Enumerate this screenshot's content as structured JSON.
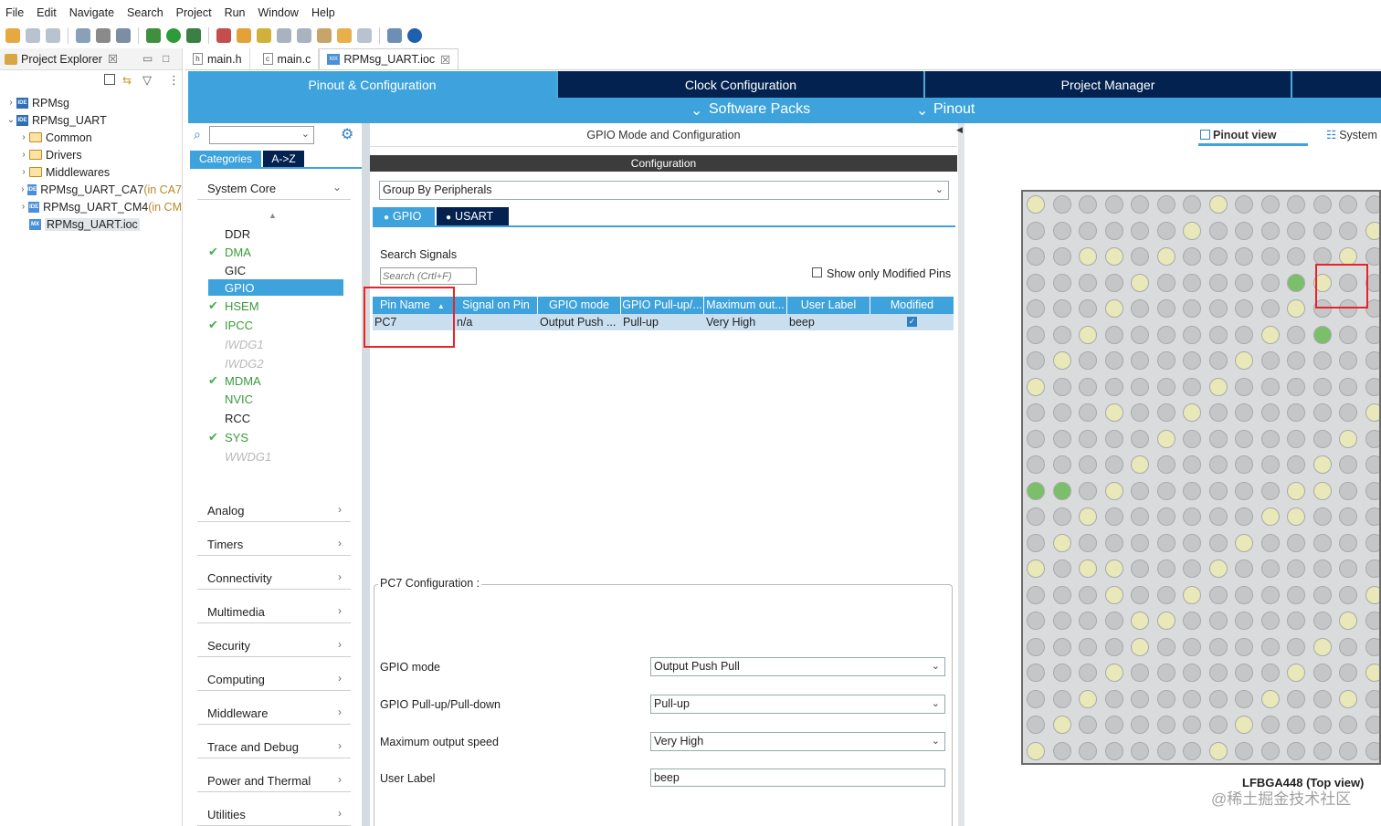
{
  "menu": [
    "File",
    "Edit",
    "Navigate",
    "Search",
    "Project",
    "Run",
    "Window",
    "Help"
  ],
  "project_explorer": {
    "title": "Project Explorer",
    "close": "☒",
    "tree": [
      {
        "label": "RPMsg",
        "suffix": ""
      },
      {
        "label": "RPMsg_UART",
        "suffix": ""
      },
      {
        "label": "Common",
        "suffix": ""
      },
      {
        "label": "Drivers",
        "suffix": ""
      },
      {
        "label": "Middlewares",
        "suffix": ""
      },
      {
        "label": "RPMsg_UART_CA7",
        "suffix": " (in CA7"
      },
      {
        "label": "RPMsg_UART_CM4",
        "suffix": " (in CM"
      },
      {
        "label": "RPMsg_UART.ioc",
        "suffix": ""
      }
    ]
  },
  "editor_tabs": [
    "main.h",
    "main.c",
    "RPMsg_UART.ioc"
  ],
  "editor_tab_close": "☒",
  "nav": {
    "tabs": [
      "Pinout & Configuration",
      "Clock Configuration",
      "Project Manager"
    ],
    "software_packs": "Software Packs",
    "pinout": "Pinout"
  },
  "categories": {
    "btn_categories": "Categories",
    "btn_az": "A->Z",
    "system_core": "System Core",
    "items": [
      {
        "label": "DDR",
        "state": "normal"
      },
      {
        "label": "DMA",
        "state": "enabled"
      },
      {
        "label": "GIC",
        "state": "normal"
      },
      {
        "label": "GPIO",
        "state": "selected"
      },
      {
        "label": "HSEM",
        "state": "enabled"
      },
      {
        "label": "IPCC",
        "state": "enabled"
      },
      {
        "label": "IWDG1",
        "state": "disabled"
      },
      {
        "label": "IWDG2",
        "state": "disabled"
      },
      {
        "label": "MDMA",
        "state": "enabled"
      },
      {
        "label": "NVIC",
        "state": "normal"
      },
      {
        "label": "RCC",
        "state": "normal"
      },
      {
        "label": "SYS",
        "state": "enabled"
      },
      {
        "label": "WWDG1",
        "state": "disabled"
      }
    ],
    "groups": [
      "Analog",
      "Timers",
      "Connectivity",
      "Multimedia",
      "Security",
      "Computing",
      "Middleware",
      "Trace and Debug",
      "Power and Thermal",
      "Utilities"
    ]
  },
  "gpio": {
    "panel_title": "GPIO Mode and Configuration",
    "config_bar": "Configuration",
    "group_by": "Group By Peripherals",
    "tab_gpio": "GPIO",
    "tab_usart": "USART",
    "search_label": "Search Signals",
    "search_placeholder": "Search (Crtl+F)",
    "show_modified": "Show only Modified Pins",
    "columns": [
      "Pin Name",
      "Signal on Pin",
      "GPIO mode",
      "GPIO Pull-up/...",
      "Maximum out...",
      "User Label",
      "Modified"
    ],
    "rows": [
      {
        "pin": "PC7",
        "signal": "n/a",
        "mode": "Output Push ...",
        "pull": "Pull-up",
        "speed": "Very High",
        "label": "beep",
        "modified": true
      }
    ],
    "pc7_title": "PC7 Configuration :",
    "fields": [
      {
        "label": "GPIO mode",
        "value": "Output Push Pull"
      },
      {
        "label": "GPIO Pull-up/Pull-down",
        "value": "Pull-up"
      },
      {
        "label": "Maximum output speed",
        "value": "Very High"
      },
      {
        "label": "User Label",
        "value": "beep"
      }
    ]
  },
  "pinout": {
    "pinout_view": "Pinout view",
    "system_view": "System",
    "package": "LFBGA448 (Top view)",
    "watermark": "@稀土掘金技术社区"
  }
}
